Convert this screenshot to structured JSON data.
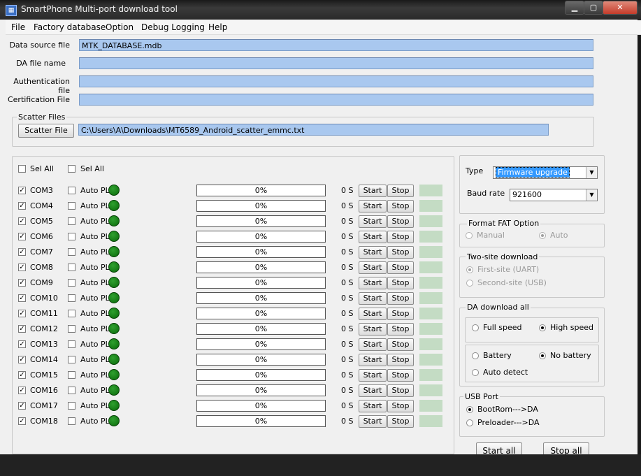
{
  "window": {
    "title": "SmartPhone Multi-port download tool",
    "min": "▁",
    "max": "▢",
    "close": "✕"
  },
  "menu": [
    "File",
    "Factory database",
    "Option",
    "Debug Logging",
    "Help"
  ],
  "files": [
    {
      "label": "Data source file",
      "value": "MTK_DATABASE.mdb"
    },
    {
      "label": "DA file name",
      "value": ""
    },
    {
      "label": "Authentication file",
      "value": ""
    },
    {
      "label": "Certification File",
      "value": ""
    }
  ],
  "scatter": {
    "group_title": "Scatter Files",
    "button": "Scatter File",
    "value": "C:\\Users\\A\\Downloads\\MT6589_Android_scatter_emmc.txt"
  },
  "sel_all": [
    "Sel All",
    "Sel All"
  ],
  "ports": [
    {
      "com": "COM3",
      "auto": "Auto PL",
      "progress": "0%",
      "time": "0 S"
    },
    {
      "com": "COM4",
      "auto": "Auto PL",
      "progress": "0%",
      "time": "0 S"
    },
    {
      "com": "COM5",
      "auto": "Auto PL",
      "progress": "0%",
      "time": "0 S"
    },
    {
      "com": "COM6",
      "auto": "Auto PL",
      "progress": "0%",
      "time": "0 S"
    },
    {
      "com": "COM7",
      "auto": "Auto PL",
      "progress": "0%",
      "time": "0 S"
    },
    {
      "com": "COM8",
      "auto": "Auto PL",
      "progress": "0%",
      "time": "0 S"
    },
    {
      "com": "COM9",
      "auto": "Auto PL",
      "progress": "0%",
      "time": "0 S"
    },
    {
      "com": "COM10",
      "auto": "Auto PL",
      "progress": "0%",
      "time": "0 S"
    },
    {
      "com": "COM11",
      "auto": "Auto PL",
      "progress": "0%",
      "time": "0 S"
    },
    {
      "com": "COM12",
      "auto": "Auto PL",
      "progress": "0%",
      "time": "0 S"
    },
    {
      "com": "COM13",
      "auto": "Auto PL",
      "progress": "0%",
      "time": "0 S"
    },
    {
      "com": "COM14",
      "auto": "Auto PL",
      "progress": "0%",
      "time": "0 S"
    },
    {
      "com": "COM15",
      "auto": "Auto PL",
      "progress": "0%",
      "time": "0 S"
    },
    {
      "com": "COM16",
      "auto": "Auto PL",
      "progress": "0%",
      "time": "0 S"
    },
    {
      "com": "COM17",
      "auto": "Auto PL",
      "progress": "0%",
      "time": "0 S"
    },
    {
      "com": "COM18",
      "auto": "Auto PL",
      "progress": "0%",
      "time": "0 S"
    }
  ],
  "row_buttons": {
    "start": "Start",
    "stop": "Stop"
  },
  "type": {
    "label": "Type",
    "value": "Firmware upgrade"
  },
  "baud": {
    "label": "Baud rate",
    "value": "921600"
  },
  "format_fat": {
    "title": "Format FAT Option",
    "manual": "Manual",
    "auto": "Auto"
  },
  "two_site": {
    "title": "Two-site download",
    "first": "First-site (UART)",
    "second": "Second-site (USB)"
  },
  "da_download": {
    "title": "DA download all",
    "full": "Full speed",
    "high": "High speed",
    "battery": "Battery",
    "no_battery": "No battery",
    "auto_detect": "Auto detect"
  },
  "usb_port": {
    "title": "USB Port",
    "bootrom": "BootRom--->DA",
    "preloader": "Preloader--->DA"
  },
  "actions": {
    "start_all": "Start all",
    "stop_all": "Stop all"
  },
  "colors": {
    "field": "#a9c8ef",
    "led": "#0a7a0a",
    "status": "#c4dcc4",
    "selection": "#3399ff"
  }
}
